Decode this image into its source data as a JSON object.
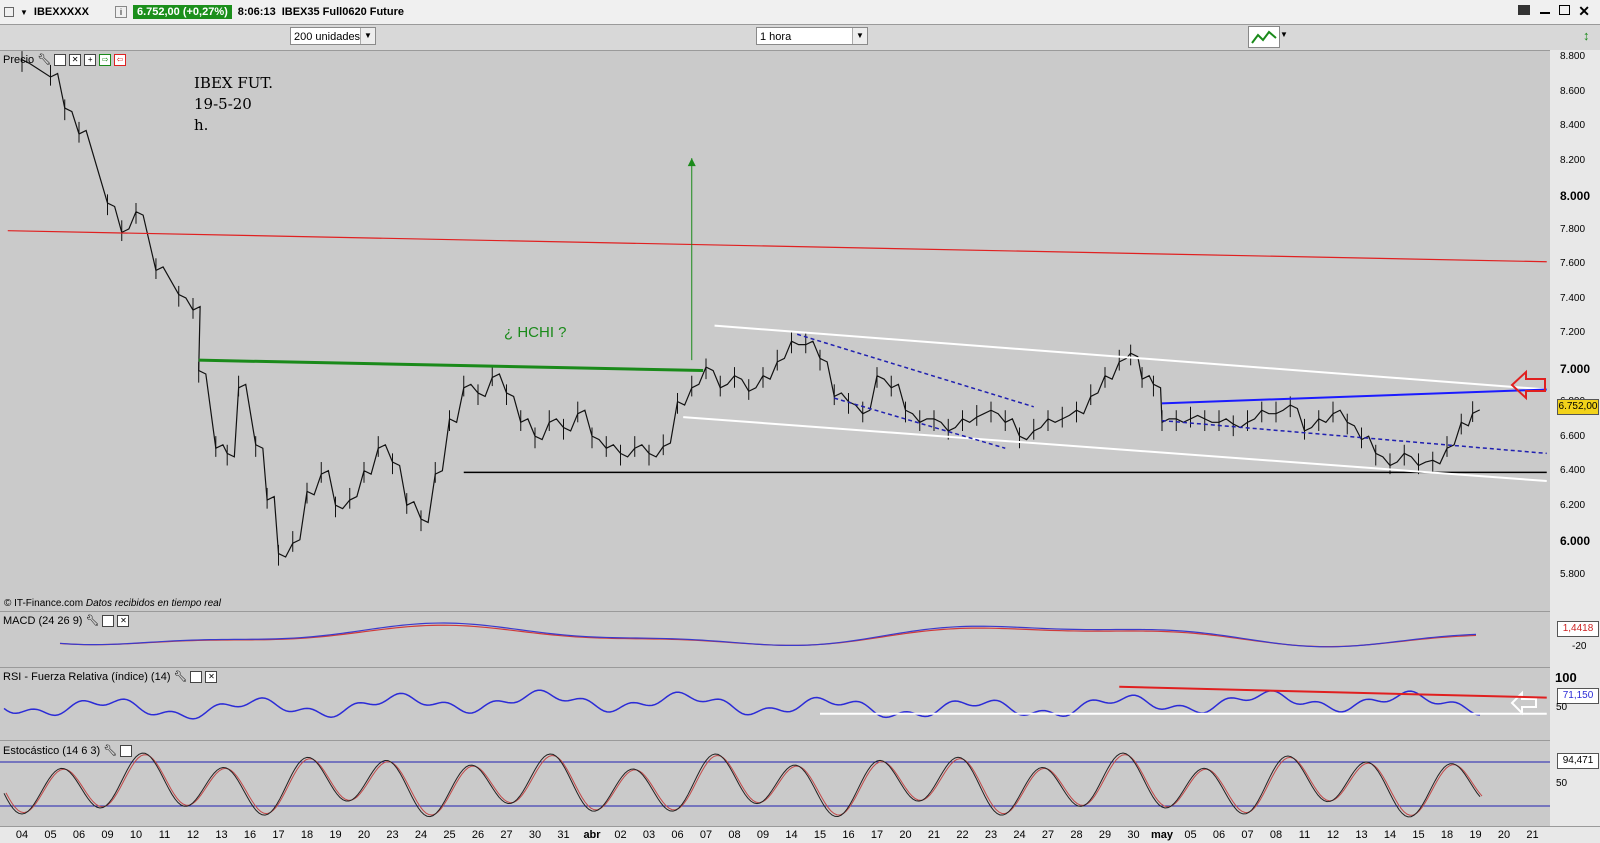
{
  "window": {
    "symbol": "IBEXXXXX",
    "info_icon": "i",
    "quote": "6.752,00 (+0,27%)",
    "time": "8:06:13",
    "instrument": "IBEX35 Full0620 Future"
  },
  "toolbar": {
    "units_value": "200 unidades",
    "interval_value": "1 hora"
  },
  "main_panel": {
    "title": "Precio",
    "annotation_lines": [
      "IBEX FUT.",
      "19-5-20",
      "h."
    ],
    "hchi_label": "¿ HCHI ?",
    "footer_source": "© IT-Finance.com",
    "footer_note": "Datos recibidos en tiempo real",
    "price_tag": "6.752,00"
  },
  "macd_panel": {
    "title": "MACD (24 26 9)",
    "value_tag": "1,4418",
    "tick_label": "-20"
  },
  "rsi_panel": {
    "title": "RSI - Fuerza Relativa (índice) (14)",
    "value_tag": "71,150",
    "tick_100": "100",
    "tick_50": "50"
  },
  "stoch_panel": {
    "title": "Estocástico (14 6 3)",
    "value_tag": "94,471",
    "tick_50": "50"
  },
  "chart_data": {
    "type": "line",
    "title": "IBEX FUT. 19-5-20 h.",
    "y_ticks": [
      "8.800",
      "8.600",
      "8.400",
      "8.200",
      "8.000",
      "7.800",
      "7.600",
      "7.400",
      "7.200",
      "7.000",
      "6.800",
      "6.600",
      "6.400",
      "6.200",
      "6.000",
      "5.800"
    ],
    "x_ticks": [
      "04",
      "05",
      "06",
      "09",
      "10",
      "11",
      "12",
      "13",
      "16",
      "17",
      "18",
      "19",
      "20",
      "23",
      "24",
      "25",
      "26",
      "27",
      "30",
      "31",
      "abr",
      "02",
      "03",
      "06",
      "07",
      "08",
      "09",
      "14",
      "15",
      "16",
      "17",
      "20",
      "21",
      "22",
      "23",
      "24",
      "27",
      "28",
      "29",
      "30",
      "may",
      "05",
      "06",
      "07",
      "08",
      "11",
      "12",
      "13",
      "14",
      "15",
      "18",
      "19",
      "20",
      "21"
    ],
    "ylim": [
      5650,
      8900
    ],
    "price_series": [
      {
        "x": 0,
        "y": 8780
      },
      {
        "x": 1,
        "y": 8700
      },
      {
        "x": 1.5,
        "y": 8500
      },
      {
        "x": 2,
        "y": 8370
      },
      {
        "x": 3,
        "y": 7950
      },
      {
        "x": 3.5,
        "y": 7800
      },
      {
        "x": 4,
        "y": 7900
      },
      {
        "x": 4.7,
        "y": 7580
      },
      {
        "x": 5.5,
        "y": 7420
      },
      {
        "x": 6,
        "y": 7350
      },
      {
        "x": 6.2,
        "y": 6980
      },
      {
        "x": 6.8,
        "y": 6550
      },
      {
        "x": 7.2,
        "y": 6500
      },
      {
        "x": 7.6,
        "y": 6900
      },
      {
        "x": 8.2,
        "y": 6550
      },
      {
        "x": 8.6,
        "y": 6250
      },
      {
        "x": 9,
        "y": 5920
      },
      {
        "x": 9.5,
        "y": 6000
      },
      {
        "x": 10,
        "y": 6280
      },
      {
        "x": 10.5,
        "y": 6400
      },
      {
        "x": 11,
        "y": 6200
      },
      {
        "x": 11.5,
        "y": 6250
      },
      {
        "x": 12,
        "y": 6400
      },
      {
        "x": 12.5,
        "y": 6550
      },
      {
        "x": 13,
        "y": 6450
      },
      {
        "x": 13.5,
        "y": 6220
      },
      {
        "x": 14,
        "y": 6120
      },
      {
        "x": 14.5,
        "y": 6400
      },
      {
        "x": 15,
        "y": 6700
      },
      {
        "x": 15.5,
        "y": 6900
      },
      {
        "x": 16,
        "y": 6850
      },
      {
        "x": 16.5,
        "y": 6960
      },
      {
        "x": 17,
        "y": 6850
      },
      {
        "x": 17.5,
        "y": 6700
      },
      {
        "x": 18,
        "y": 6600
      },
      {
        "x": 18.5,
        "y": 6700
      },
      {
        "x": 19,
        "y": 6650
      },
      {
        "x": 19.5,
        "y": 6750
      },
      {
        "x": 20,
        "y": 6600
      },
      {
        "x": 20.5,
        "y": 6550
      },
      {
        "x": 21,
        "y": 6500
      },
      {
        "x": 21.5,
        "y": 6550
      },
      {
        "x": 22,
        "y": 6500
      },
      {
        "x": 22.5,
        "y": 6560
      },
      {
        "x": 23,
        "y": 6800
      },
      {
        "x": 23.5,
        "y": 6900
      },
      {
        "x": 24,
        "y": 7000
      },
      {
        "x": 24.5,
        "y": 6900
      },
      {
        "x": 25,
        "y": 6950
      },
      {
        "x": 25.5,
        "y": 6880
      },
      {
        "x": 26,
        "y": 6950
      },
      {
        "x": 26.5,
        "y": 7050
      },
      {
        "x": 27,
        "y": 7150
      },
      {
        "x": 27.5,
        "y": 7150
      },
      {
        "x": 28,
        "y": 7050
      },
      {
        "x": 28.5,
        "y": 6850
      },
      {
        "x": 29,
        "y": 6800
      },
      {
        "x": 29.5,
        "y": 6750
      },
      {
        "x": 30,
        "y": 6950
      },
      {
        "x": 30.5,
        "y": 6900
      },
      {
        "x": 31,
        "y": 6750
      },
      {
        "x": 31.5,
        "y": 6700
      },
      {
        "x": 32,
        "y": 6700
      },
      {
        "x": 32.5,
        "y": 6650
      },
      {
        "x": 33,
        "y": 6700
      },
      {
        "x": 33.5,
        "y": 6730
      },
      {
        "x": 34,
        "y": 6750
      },
      {
        "x": 34.5,
        "y": 6700
      },
      {
        "x": 35,
        "y": 6600
      },
      {
        "x": 35.5,
        "y": 6650
      },
      {
        "x": 36,
        "y": 6700
      },
      {
        "x": 36.5,
        "y": 6720
      },
      {
        "x": 37,
        "y": 6750
      },
      {
        "x": 37.5,
        "y": 6850
      },
      {
        "x": 38,
        "y": 6950
      },
      {
        "x": 38.5,
        "y": 7050
      },
      {
        "x": 38.9,
        "y": 7080
      },
      {
        "x": 39.3,
        "y": 6950
      },
      {
        "x": 39.7,
        "y": 6900
      },
      {
        "x": 40,
        "y": 6700
      },
      {
        "x": 40.5,
        "y": 6700
      },
      {
        "x": 41,
        "y": 6720
      },
      {
        "x": 41.5,
        "y": 6700
      },
      {
        "x": 42,
        "y": 6700
      },
      {
        "x": 42.5,
        "y": 6670
      },
      {
        "x": 43,
        "y": 6700
      },
      {
        "x": 43.5,
        "y": 6750
      },
      {
        "x": 44,
        "y": 6750
      },
      {
        "x": 44.5,
        "y": 6780
      },
      {
        "x": 45,
        "y": 6650
      },
      {
        "x": 45.5,
        "y": 6700
      },
      {
        "x": 46,
        "y": 6750
      },
      {
        "x": 46.5,
        "y": 6680
      },
      {
        "x": 47,
        "y": 6600
      },
      {
        "x": 47.5,
        "y": 6500
      },
      {
        "x": 48,
        "y": 6450
      },
      {
        "x": 48.5,
        "y": 6500
      },
      {
        "x": 49,
        "y": 6450
      },
      {
        "x": 49.5,
        "y": 6460
      },
      {
        "x": 50,
        "y": 6550
      },
      {
        "x": 50.5,
        "y": 6680
      },
      {
        "x": 50.9,
        "y": 6752
      }
    ],
    "lines": [
      {
        "name": "red",
        "from": {
          "x": -0.5,
          "y": 7800
        },
        "to": {
          "x": 53.5,
          "y": 7620
        }
      },
      {
        "name": "green",
        "from": {
          "x": 6.2,
          "y": 7050
        },
        "to": {
          "x": 23.9,
          "y": 6990
        }
      },
      {
        "name": "black",
        "from": {
          "x": 15.5,
          "y": 6400
        },
        "to": {
          "x": 53.5,
          "y": 6400
        }
      },
      {
        "name": "white-upper",
        "from": {
          "x": 24.3,
          "y": 7250
        },
        "to": {
          "x": 53.5,
          "y": 6880
        }
      },
      {
        "name": "white-lower",
        "from": {
          "x": 23.2,
          "y": 6720
        },
        "to": {
          "x": 53.5,
          "y": 6350
        }
      },
      {
        "name": "blue-solid",
        "from": {
          "x": 40,
          "y": 6800
        },
        "to": {
          "x": 53.5,
          "y": 6880
        }
      },
      {
        "name": "dash-1-upper",
        "from": {
          "x": 27.2,
          "y": 7200
        },
        "to": {
          "x": 35.5,
          "y": 6780
        }
      },
      {
        "name": "dash-1-lower",
        "from": {
          "x": 28.5,
          "y": 6830
        },
        "to": {
          "x": 34.5,
          "y": 6540
        }
      },
      {
        "name": "dash-2",
        "from": {
          "x": 40,
          "y": 6700
        },
        "to": {
          "x": 53.5,
          "y": 6510
        }
      },
      {
        "name": "green-arrow",
        "from": {
          "x": 23.5,
          "y": 7050
        },
        "to": {
          "x": 23.5,
          "y": 8220
        }
      }
    ],
    "rsi_lines": [
      {
        "name": "rsi-red",
        "from": {
          "x": 38.5,
          "y": 80
        },
        "to": {
          "x": 53.5,
          "y": 60
        }
      },
      {
        "name": "rsi-white",
        "from": {
          "x": 28,
          "y": 30
        },
        "to": {
          "x": 53.5,
          "y": 30
        }
      }
    ],
    "grid": false,
    "colors": {
      "price": "#111111",
      "red_line": "#e02020",
      "green_line": "#1a8a1a",
      "blue_line": "#1a1aff",
      "rsi": "#2b2bd6",
      "macd": "#3a3acc",
      "signal": "#d03a3a"
    }
  }
}
